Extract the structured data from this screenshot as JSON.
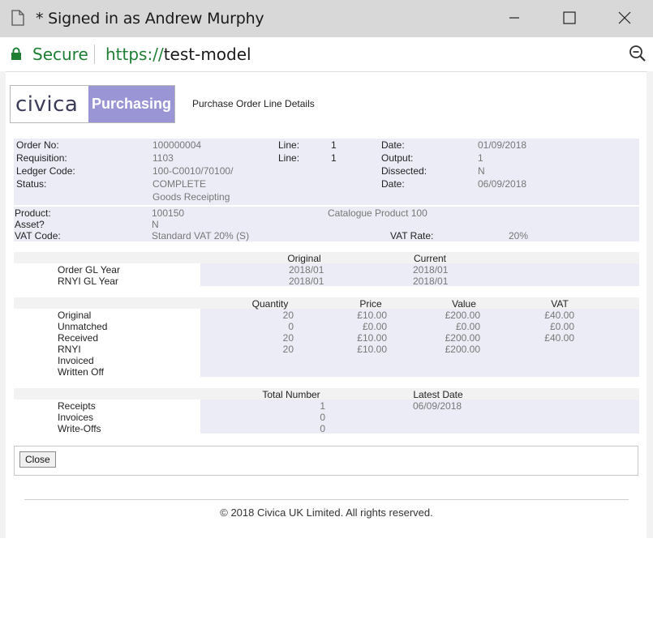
{
  "window": {
    "title": "* Signed in as Andrew Murphy"
  },
  "address": {
    "security": "Secure",
    "url_scheme": "https://",
    "url_host": "test-model"
  },
  "logo": {
    "brand": "civica",
    "product": "Purchasing"
  },
  "page": {
    "heading": "Purchase Order Line Details"
  },
  "details": {
    "order_no_label": "Order No:",
    "order_no": "100000004",
    "line1_label": "Line:",
    "line1": "1",
    "date1_label": "Date:",
    "date1": "01/09/2018",
    "requisition_label": "Requisition:",
    "requisition": "1103",
    "line2_label": "Line:",
    "line2": "1",
    "output_label": "Output:",
    "output": "1",
    "ledger_label": "Ledger Code:",
    "ledger": "100-C0010/70100/",
    "dissected_label": "Dissected:",
    "dissected": "N",
    "status_label": "Status:",
    "status": "COMPLETE",
    "status2": "Goods Receipting",
    "date2_label": "Date:",
    "date2": "06/09/2018",
    "product_label": "Product:",
    "product": "100150",
    "product_desc": "Catalogue Product 100",
    "asset_label": "Asset?",
    "asset": "N",
    "vat_code_label": "VAT Code:",
    "vat_code": "Standard VAT 20% (S)",
    "vat_rate_label": "VAT Rate:",
    "vat_rate": "20%"
  },
  "gl_table": {
    "headers": [
      "Original",
      "Current"
    ],
    "rows": [
      {
        "label": "Order GL Year",
        "original": "2018/01",
        "current": "2018/01"
      },
      {
        "label": "RNYI GL Year",
        "original": "2018/01",
        "current": "2018/01"
      }
    ]
  },
  "qty_table": {
    "headers": [
      "Quantity",
      "Price",
      "Value",
      "VAT"
    ],
    "rows": [
      {
        "label": "Original",
        "quantity": "20",
        "price": "£10.00",
        "value": "£200.00",
        "vat": "£40.00"
      },
      {
        "label": "Unmatched",
        "quantity": "0",
        "price": "£0.00",
        "value": "£0.00",
        "vat": "£0.00"
      },
      {
        "label": "Received",
        "quantity": "20",
        "price": "£10.00",
        "value": "£200.00",
        "vat": "£40.00"
      },
      {
        "label": "RNYI",
        "quantity": "20",
        "price": "£10.00",
        "value": "£200.00",
        "vat": ""
      },
      {
        "label": "Invoiced",
        "quantity": "",
        "price": "",
        "value": "",
        "vat": ""
      },
      {
        "label": "Written Off",
        "quantity": "",
        "price": "",
        "value": "",
        "vat": ""
      }
    ]
  },
  "totals_table": {
    "headers": [
      "Total Number",
      "Latest Date"
    ],
    "rows": [
      {
        "label": "Receipts",
        "total": "1",
        "latest": "06/09/2018"
      },
      {
        "label": "Invoices",
        "total": "0",
        "latest": ""
      },
      {
        "label": "Write-Offs",
        "total": "0",
        "latest": ""
      }
    ]
  },
  "actions": {
    "close_label": "Close"
  },
  "footer": {
    "copyright": "© 2018 Civica UK Limited. All rights reserved."
  }
}
